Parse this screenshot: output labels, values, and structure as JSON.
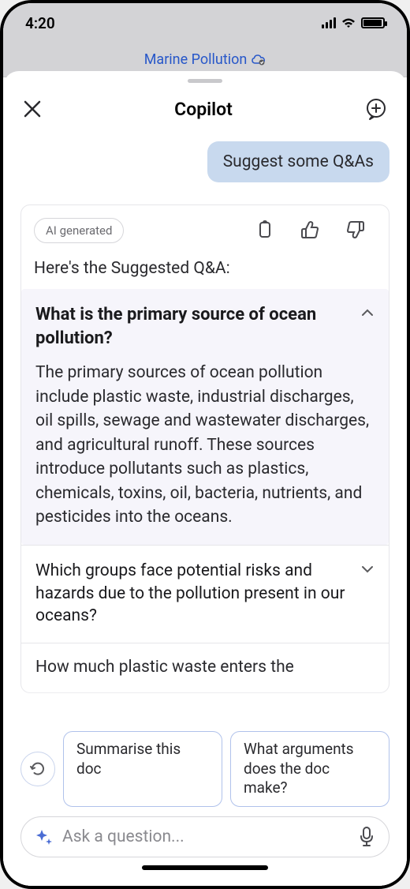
{
  "status": {
    "time": "4:20"
  },
  "doc_bar": {
    "title": "Marine Pollution"
  },
  "sheet": {
    "title": "Copilot",
    "user_message": "Suggest some Q&As",
    "response": {
      "ai_tag": "AI generated",
      "intro": "Here's the Suggested Q&A:",
      "qa": [
        {
          "question": "What is the primary source of ocean pollution?",
          "answer": "The primary sources of ocean pollution include plastic waste, industrial discharges, oil spills, sewage and wastewater discharges, and agricultural runoff. These sources introduce pollutants such as plastics, chemicals, toxins, oil, bacteria, nutrients, and pesticides into the oceans.",
          "expanded": true
        },
        {
          "question": "Which groups face potential risks and hazards due to the pollution present in our oceans?",
          "expanded": false
        },
        {
          "question_partial": "How much plastic waste enters the"
        }
      ]
    }
  },
  "suggestions": [
    "Summarise this doc",
    "What arguments does the doc make?"
  ],
  "input": {
    "placeholder": "Ask a question..."
  }
}
